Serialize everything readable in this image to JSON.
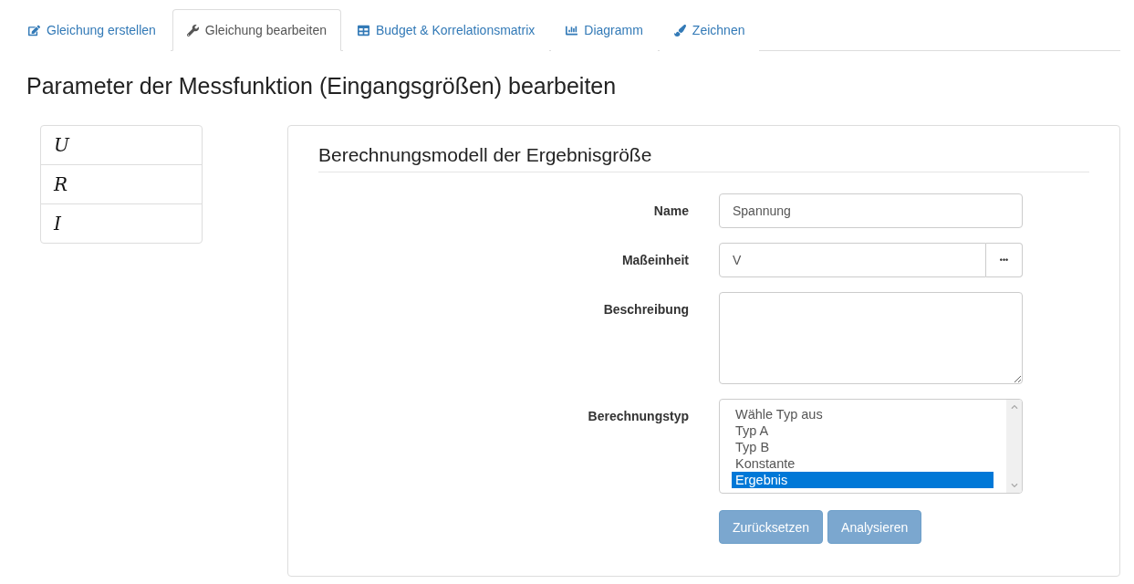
{
  "tabs": [
    {
      "label": "Gleichung erstellen",
      "selected": false
    },
    {
      "label": "Gleichung bearbeiten",
      "selected": true
    },
    {
      "label": "Budget & Korrelationsmatrix",
      "selected": false
    },
    {
      "label": "Diagramm",
      "selected": false
    },
    {
      "label": "Zeichnen",
      "selected": false
    }
  ],
  "page_title": "Parameter der Messfunktion (Eingangsgrößen) bearbeiten",
  "variables": [
    {
      "label": "U",
      "selected": false
    },
    {
      "label": "R",
      "selected": false
    },
    {
      "label": "I",
      "selected": false
    }
  ],
  "panel": {
    "title": "Berechnungsmodell der Ergebnisgröße",
    "fields": [
      {
        "kind": "text",
        "label": "Name",
        "value": "Spannung"
      },
      {
        "kind": "addon",
        "label": "Maßeinheit",
        "value": "V",
        "addon": "•••"
      },
      {
        "kind": "textarea",
        "label": "Beschreibung"
      },
      {
        "kind": "listbox",
        "label": "Berechnungstyp",
        "options": [
          {
            "label": "Wähle Typ aus",
            "selected": false
          },
          {
            "label": "Typ A",
            "selected": false
          },
          {
            "label": "Typ B",
            "selected": false
          },
          {
            "label": "Konstante",
            "selected": false
          },
          {
            "label": "Ergebnis",
            "selected": true
          }
        ]
      }
    ],
    "buttons": [
      {
        "label": "Zurücksetzen",
        "disabled": true
      },
      {
        "label": "Analysieren",
        "disabled": true
      }
    ]
  }
}
